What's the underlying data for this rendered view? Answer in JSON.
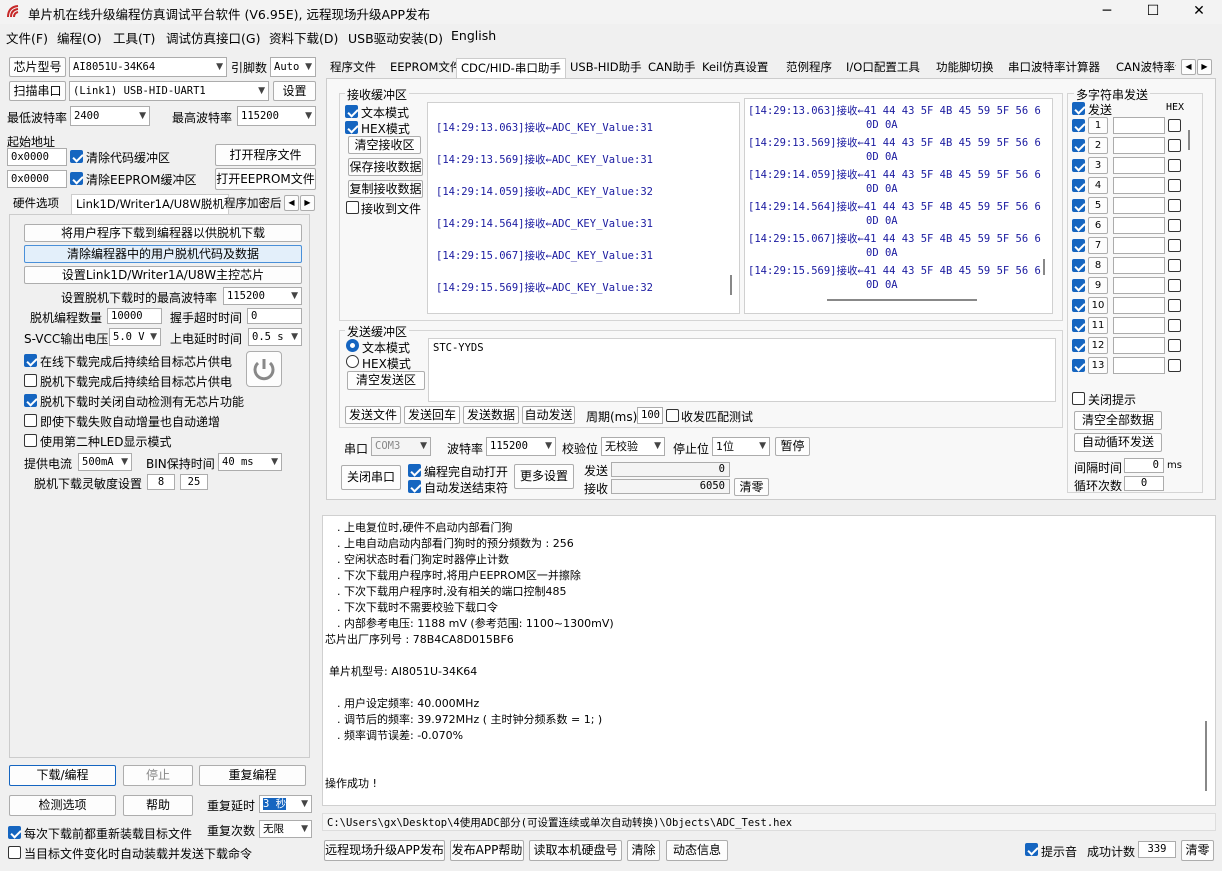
{
  "window": {
    "title": "单片机在线升级编程仿真调试平台软件 (V6.95E), 远程现场升级APP发布",
    "min": "─",
    "max": "☐",
    "close": "✕"
  },
  "menu": [
    "文件(F)",
    "编程(O)",
    "工具(T)",
    "调试仿真接口(G)",
    "资料下载(D)",
    "USB驱动安装(D)",
    "English"
  ],
  "left": {
    "chip_label": "芯片型号",
    "chip_value": "AI8051U-34K64",
    "pins_label": "引脚数",
    "pins_value": "Auto",
    "scan_button": "扫描串口",
    "port_value": "(Link1) USB-HID-UART1",
    "settings_button": "设置",
    "min_baud_label": "最低波特率",
    "min_baud_value": "2400",
    "max_baud_label": "最高波特率",
    "max_baud_value": "115200",
    "start_addr_label": "起始地址",
    "addr1": "0x0000",
    "clear_code_label": "清除代码缓冲区",
    "open_prog_button": "打开程序文件",
    "addr2": "0x0000",
    "clear_eeprom_label": "清除EEPROM缓冲区",
    "open_eeprom_button": "打开EEPROM文件",
    "tabs": [
      "硬件选项",
      "Link1D/Writer1A/U8W脱机",
      "程序加密后"
    ],
    "offline": {
      "btn1": "将用户程序下载到编程器以供脱机下载",
      "btn2": "清除编程器中的用户脱机代码及数据",
      "btn3": "设置Link1D/Writer1A/U8W主控芯片",
      "max_baud_label": "设置脱机下载时的最高波特率",
      "max_baud_value": "115200",
      "count_label": "脱机编程数量",
      "count_value": "10000",
      "handshake_label": "握手超时时间",
      "handshake_value": "0",
      "svcc_label": "S-VCC输出电压",
      "svcc_value": "5.0 V",
      "delay_label": "上电延时时间",
      "delay_value": "0.5 s",
      "opt1": "在线下载完成后持续给目标芯片供电",
      "opt2": "脱机下载完成后持续给目标芯片供电",
      "opt3": "脱机下载时关闭自动检测有无芯片功能",
      "opt4": "即使下载失败自动增量也自动递增",
      "opt5": "使用第二种LED显示模式",
      "current_label": "提供电流",
      "current_value": "500mA",
      "bin_label": "BIN保持时间",
      "bin_value": "40 ms",
      "sens_label": "脱机下载灵敏度设置",
      "sens1": "8",
      "sens2": "25"
    },
    "download_button": "下载/编程",
    "stop_button": "停止",
    "repeat_button": "重复编程",
    "check_button": "检测选项",
    "help_button": "帮助",
    "repeat_delay_label": "重复延时",
    "repeat_delay_value": "3 秒",
    "reload_label": "每次下载前都重新装载目标文件",
    "repeat_count_label": "重复次数",
    "repeat_count_value": "无限",
    "autoload_label": "当目标文件变化时自动装载并发送下载命令"
  },
  "tabs": [
    "程序文件",
    "EEPROM文件",
    "CDC/HID-串口助手",
    "USB-HID助手",
    "CAN助手",
    "Keil仿真设置",
    "范例程序",
    "I/O口配置工具",
    "功能脚切换",
    "串口波特率计算器",
    "CAN波特率计"
  ],
  "recv": {
    "title": "接收缓冲区",
    "text_mode": "文本模式",
    "hex_mode": "HEX模式",
    "clear": "清空接收区",
    "save": "保存接收数据",
    "copy": "复制接收数据",
    "to_file": "接收到文件",
    "text_lines": [
      "[14:29:13.063]接收←ADC_KEY_Value:31",
      "[14:29:13.569]接收←ADC_KEY_Value:31",
      "[14:29:14.059]接收←ADC_KEY_Value:32",
      "[14:29:14.564]接收←ADC_KEY_Value:31",
      "[14:29:15.067]接收←ADC_KEY_Value:31",
      "[14:29:15.569]接收←ADC_KEY_Value:32"
    ],
    "hex_lines": [
      "[14:29:13.063]接收←41 44 43 5F 4B 45 59 5F 56 6",
      "0D 0A",
      "[14:29:13.569]接收←41 44 43 5F 4B 45 59 5F 56 6",
      "0D 0A",
      "[14:29:14.059]接收←41 44 43 5F 4B 45 59 5F 56 6",
      "0D 0A",
      "[14:29:14.564]接收←41 44 43 5F 4B 45 59 5F 56 6",
      "0D 0A",
      "[14:29:15.067]接收←41 44 43 5F 4B 45 59 5F 56 6",
      "0D 0A",
      "[14:29:15.569]接收←41 44 43 5F 4B 45 59 5F 56 6",
      "0D 0A"
    ]
  },
  "send": {
    "title": "发送缓冲区",
    "text_mode": "文本模式",
    "hex_mode": "HEX模式",
    "clear": "清空发送区",
    "content": "STC-YYDS",
    "send_file": "发送文件",
    "send_enter": "发送回车",
    "send_data": "发送数据",
    "auto_send": "自动发送",
    "period_label": "周期(ms)",
    "period_value": "100",
    "match_label": "收发匹配测试"
  },
  "port": {
    "port_label": "串口",
    "port_value": "COM3",
    "baud_label": "波特率",
    "baud_value": "115200",
    "parity_label": "校验位",
    "parity_value": "无校验",
    "stop_label": "停止位",
    "stop_value": "1位",
    "pause": "暂停",
    "close": "关闭串口",
    "auto_open": "编程完自动打开",
    "auto_end": "自动发送结束符",
    "more": "更多设置",
    "sent_label": "发送",
    "sent_value": "0",
    "recv_label": "接收",
    "recv_value": "6050",
    "clear": "清零"
  },
  "multi": {
    "title": "多字符串发送",
    "send_col": "发送",
    "hex_col": "HEX",
    "rows": [
      "1",
      "2",
      "3",
      "4",
      "5",
      "6",
      "7",
      "8",
      "9",
      "10",
      "11",
      "12",
      "13"
    ],
    "close_hint": "关闭提示",
    "clear_all": "清空全部数据",
    "auto_loop": "自动循环发送",
    "interval_label": "间隔时间",
    "interval_value": "0",
    "interval_unit": "ms",
    "loop_label": "循环次数",
    "loop_value": "0"
  },
  "output": {
    "lines": [
      ". 上电复位时,硬件不启动内部看门狗",
      ". 上电自动启动内部看门狗时的预分频数为 : 256",
      ". 空闲状态时看门狗定时器停止计数",
      ". 下次下载用户程序时,将用户EEPROM区一并擦除",
      ". 下次下载用户程序时,没有相关的端口控制485",
      ". 下次下载时不需要校验下载口令",
      ". 内部参考电压: 1188 mV (参考范围: 1100~1300mV)",
      "芯片出厂序列号 : 78B4CA8D015BF6",
      "",
      "  单片机型号: AI8051U-34K64",
      "",
      ". 用户设定频率: 40.000MHz",
      ". 调节后的频率: 39.972MHz ( 主时钟分频系数 = 1; )",
      ". 频率调节误差: -0.070%",
      "",
      "",
      "操作成功 !"
    ],
    "path": "C:\\Users\\gx\\Desktop\\4使用ADC部分(可设置连续或单次自动转换)\\Objects\\ADC_Test.hex"
  },
  "bottom": {
    "btn1": "远程现场升级APP发布",
    "btn2": "发布APP帮助",
    "btn3": "读取本机硬盘号",
    "btn4": "清除",
    "btn5": "动态信息",
    "sound_label": "提示音",
    "success_label": "成功计数",
    "success_value": "339",
    "clear": "清零"
  },
  "colors": {
    "accent": "#1565c0",
    "log_text": "#1a1aa0"
  }
}
